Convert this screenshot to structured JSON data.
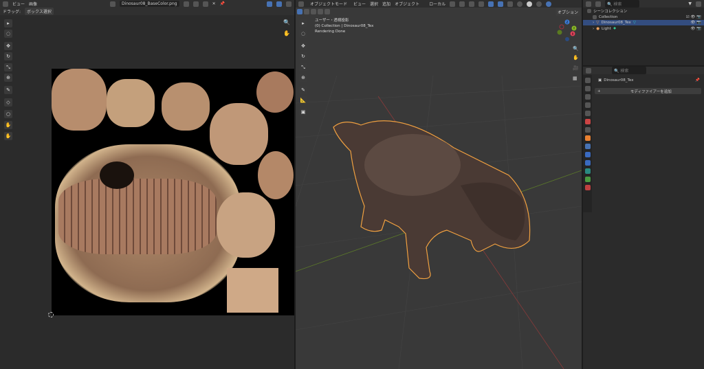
{
  "image_editor": {
    "menu": [
      "ビュー",
      "画像"
    ],
    "image_name": "Dinosaur08_BaseColor.png",
    "drag_label": "ドラッグ:",
    "drag_mode": "ボックス選択"
  },
  "viewport": {
    "mode": "オブジェクトモード",
    "menu": [
      "ビュー",
      "選択",
      "追加",
      "オブジェクト"
    ],
    "orientation": "ローカル",
    "options": "オプション",
    "overlay_lines": [
      "ユーザー・透視投影",
      "(0) Collection | Dinosaur08_Tex",
      "Rendering Done"
    ],
    "gizmo": {
      "z": "Z",
      "y": "Y",
      "x": "X"
    }
  },
  "outliner": {
    "search_placeholder": "検索",
    "scene_collection": "シーンコレクション",
    "items": [
      {
        "label": "Collection"
      },
      {
        "label": "Dinosaur08_Tex",
        "selected": true
      },
      {
        "label": "Light"
      }
    ]
  },
  "properties": {
    "search_placeholder": "検索",
    "object_name": "Dinosaur08_Tex",
    "add_modifier": "モディファイアーを追加"
  },
  "colors": {
    "accent": "#4772b3",
    "selection_outline": "#f0a040"
  }
}
